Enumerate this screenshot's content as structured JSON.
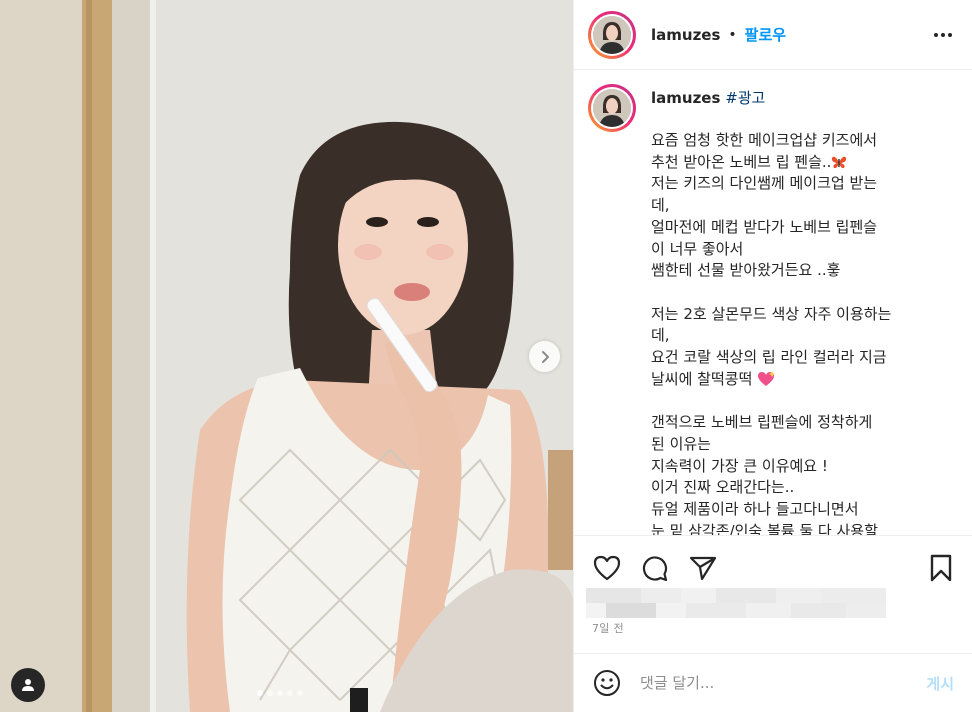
{
  "post": {
    "username": "lamuzes",
    "follow_label": "팔로우",
    "separator": "•",
    "hashtag": "#광고",
    "caption_lines": [
      "요즘 엄청 핫한 메이크업샵 키즈에서",
      "추천 받아온 노베브 립 펜슬..",
      "저는 키즈의 다인쌤께 메이크업 받는",
      "데,",
      "얼마전에 메컵 받다가 노베브 립펜슬",
      "이 너무 좋아서",
      "쌤한테 선물 받아왔거든요 ..훟",
      "",
      "저는 2호 살몬무드 색상 자주 이용하는",
      "데,",
      "요건 코랄 색상의 립 라인 컬러라 지금",
      "날씨에 찰떡콩떡",
      "",
      "갠적으로 노베브 립펜슬에 정착하게",
      "된 이유는",
      "지속력이 가장 큰 이유예요 !",
      "이거 진짜 오래간다는..",
      "듀얼 제품이라 하나 들고다니면서",
      "눈 밑 삼각존/인숙 볼륨 둘 다 사용할"
    ],
    "timestamp": "7일 전",
    "comment_placeholder": "댓글 달기...",
    "post_button_label": "게시"
  },
  "carousel": {
    "slide_count": 5,
    "active_index": 0
  },
  "icons": {
    "more": "more-options-icon",
    "like": "heart-icon",
    "comment": "comment-icon",
    "share": "paper-plane-icon",
    "save": "bookmark-icon",
    "emoji": "smiley-icon",
    "next": "chevron-right-icon",
    "tagged": "person-icon"
  },
  "colors": {
    "accent": "#0095f6",
    "hashtag": "#00376b",
    "post_button_disabled": "#b2dffc",
    "muted": "#8e8e8e",
    "ring_start": "#f9a825",
    "ring_end": "#c13584"
  }
}
